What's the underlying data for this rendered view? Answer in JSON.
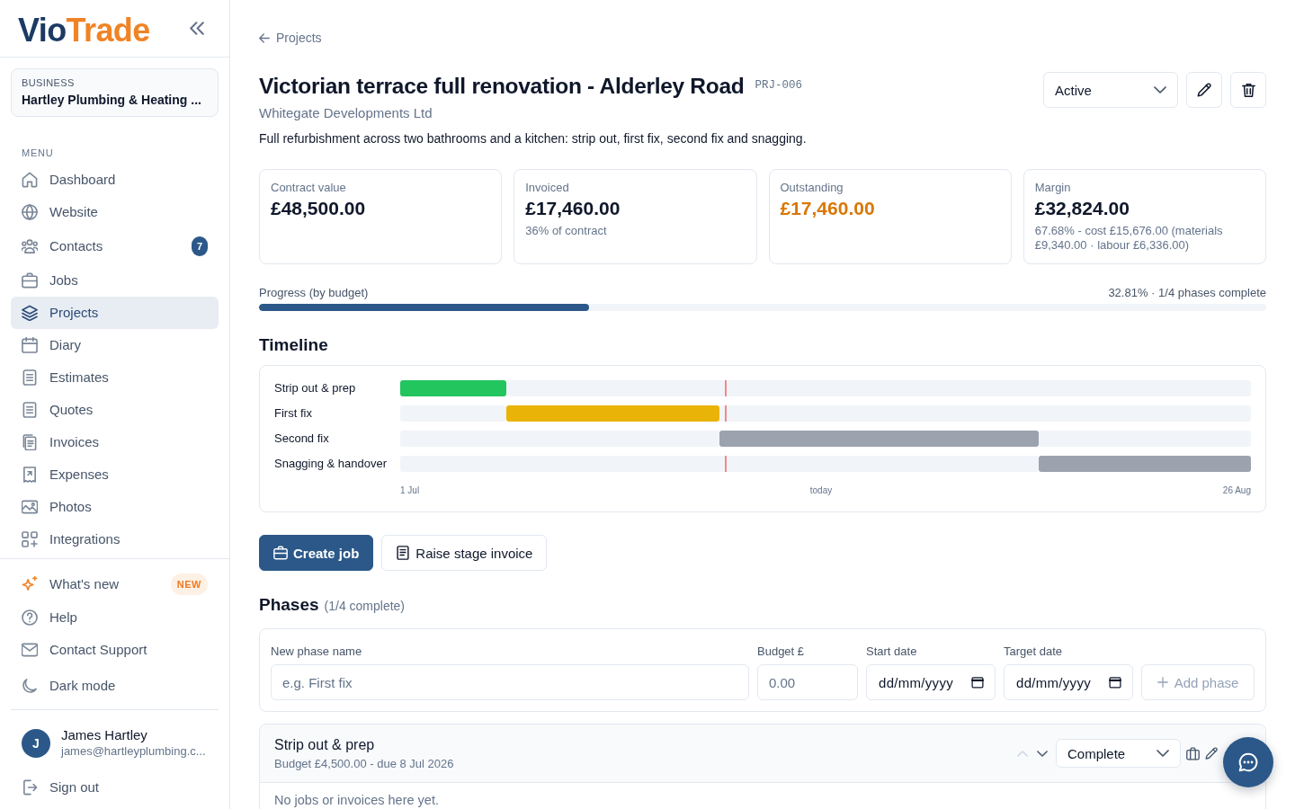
{
  "sidebar": {
    "logo": [
      "Vio",
      "Trade"
    ],
    "business": {
      "label": "BUSINESS",
      "name": "Hartley Plumbing & Heating ..."
    },
    "menu_heading": "MENU",
    "menu": [
      {
        "label": "Dashboard",
        "selected": false
      },
      {
        "label": "Website",
        "selected": false
      },
      {
        "label": "Contacts",
        "selected": false,
        "badge": "7"
      },
      {
        "label": "Jobs",
        "selected": false
      },
      {
        "label": "Projects",
        "selected": true
      },
      {
        "label": "Diary",
        "selected": false
      },
      {
        "label": "Estimates",
        "selected": false
      },
      {
        "label": "Quotes",
        "selected": false
      },
      {
        "label": "Invoices",
        "selected": false
      },
      {
        "label": "Expenses",
        "selected": false
      },
      {
        "label": "Photos",
        "selected": false
      },
      {
        "label": "Integrations",
        "selected": false
      }
    ],
    "extras": [
      {
        "label": "What's new",
        "badge": "NEW"
      },
      {
        "label": "Help"
      },
      {
        "label": "Contact Support"
      },
      {
        "label": "Dark mode"
      }
    ],
    "user": {
      "initial": "J",
      "name": "James Hartley",
      "email": "james@hartleyplumbing.c..."
    },
    "sign_out": "Sign out"
  },
  "main": {
    "back_link": "Projects",
    "project": {
      "title": "Victorian terrace full renovation - Alderley Road",
      "code": "PRJ-006",
      "client": "Whitegate Developments Ltd",
      "description": "Full refurbishment across two bathrooms and a kitchen: strip out, first fix, second fix and snagging."
    },
    "status_select": {
      "value": "Active"
    },
    "stats": [
      {
        "label": "Contract value",
        "value": "£48,500.00",
        "warning": false
      },
      {
        "label": "Invoiced",
        "value": "£17,460.00",
        "note": "36% of contract",
        "warning": false
      },
      {
        "label": "Outstanding",
        "value": "£17,460.00",
        "warning": true
      },
      {
        "label": "Margin",
        "value": "£32,824.00",
        "note": "67.68% - cost £15,676.00 (materials £9,340.00 · labour £6,336.00)",
        "warning": false
      }
    ],
    "progress": {
      "label": "Progress (by budget)",
      "summary": "32.81% · 1/4 phases complete",
      "level": 0.3281
    },
    "timeline": {
      "title": "Timeline",
      "rows": [
        {
          "label": "Strip out & prep",
          "color": "#22c55e"
        },
        {
          "label": "First fix",
          "color": "#eab308"
        },
        {
          "label": "Second fix",
          "color": "#9ca3af"
        },
        {
          "label": "Snagging & handover",
          "color": "#9ca3af"
        }
      ],
      "axis_labels": [
        "1 Jul",
        "today",
        "26 Aug"
      ]
    },
    "actions": [
      {
        "label": "Create job",
        "kind": "primary"
      },
      {
        "label": "Raise stage invoice",
        "kind": "secondary"
      }
    ],
    "phases": {
      "title": "Phases",
      "count": "(1/4 complete)",
      "form": {
        "fields": [
          {
            "label": "New phase name",
            "placeholder": "e.g. First fix",
            "kind": "text"
          },
          {
            "label": "Budget £",
            "placeholder": "0.00",
            "kind": "number"
          },
          {
            "label": "Start date",
            "placeholder": "dd/mm/yyyy",
            "kind": "date"
          },
          {
            "label": "Target date",
            "placeholder": "dd/mm/yyyy",
            "kind": "date"
          }
        ],
        "add_button": {
          "label": "Add phase",
          "disabled": true
        }
      },
      "items": [
        {
          "title": "Strip out & prep",
          "meta": "Budget £4,500.00 - due 8 Jul 2026",
          "status": "Complete",
          "up_disabled": true,
          "down_disabled": false,
          "empty_text": "No jobs or invoices here yet."
        }
      ]
    }
  }
}
